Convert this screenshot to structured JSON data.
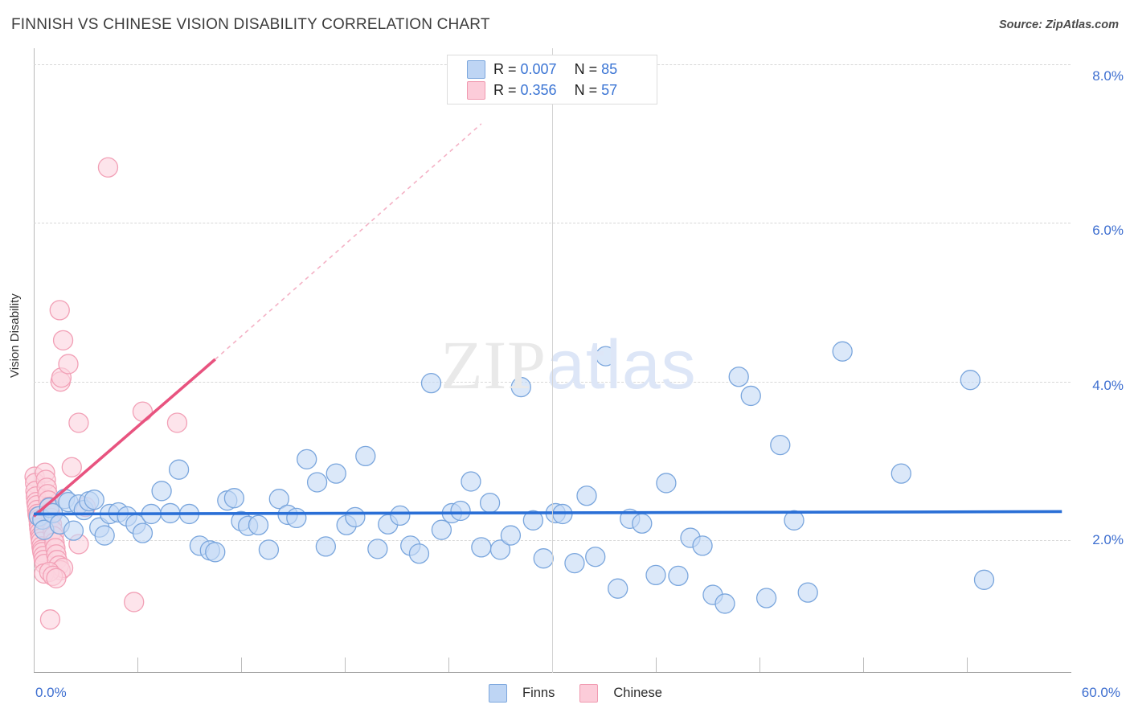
{
  "header": {
    "title": "FINNISH VS CHINESE VISION DISABILITY CORRELATION CHART",
    "source": "Source: ZipAtlas.com"
  },
  "watermark": {
    "zip": "ZIP",
    "atlas": "atlas"
  },
  "stats": {
    "finns": {
      "r_label": "R =",
      "r_value": "0.007",
      "n_label": "N =",
      "n_value": "85"
    },
    "chinese": {
      "r_label": "R =",
      "r_value": "0.356",
      "n_label": "N =",
      "n_value": "57"
    }
  },
  "legend": {
    "finns": "Finns",
    "chinese": "Chinese"
  },
  "colors": {
    "finns_fill": "#c5daf6",
    "finns_stroke": "#7aa6dd",
    "finns_trend": "#2a6fd6",
    "chinese_fill": "#fcd4de",
    "chinese_stroke": "#f2a0b6",
    "chinese_trend": "#e8537f",
    "axis_label": "#3e6fd0"
  },
  "chart_data": {
    "type": "scatter",
    "title": "FINNISH VS CHINESE VISION DISABILITY CORRELATION CHART",
    "xlabel": "",
    "ylabel": "Vision Disability",
    "xlim": [
      0.0,
      60.0
    ],
    "ylim": [
      0.0,
      8.6
    ],
    "x_tick_labels": [
      "0.0%",
      "60.0%"
    ],
    "y_tick_labels": [
      "2.0%",
      "4.0%",
      "6.0%",
      "8.0%"
    ],
    "y_ticks": [
      2.0,
      4.0,
      6.0,
      8.0
    ],
    "grid": true,
    "legend_position": "bottom",
    "series": [
      {
        "name": "Finns",
        "color": "#c5daf6",
        "r": 0.007,
        "n": 85,
        "trendline": {
          "x0": 0.0,
          "y0": 2.33,
          "x1": 59.5,
          "y1": 2.36
        },
        "points": [
          [
            0.3,
            2.3
          ],
          [
            0.5,
            2.26
          ],
          [
            0.6,
            2.13
          ],
          [
            0.9,
            2.41
          ],
          [
            1.1,
            2.34
          ],
          [
            1.5,
            2.2
          ],
          [
            1.8,
            2.52
          ],
          [
            2.0,
            2.48
          ],
          [
            2.3,
            2.12
          ],
          [
            2.6,
            2.45
          ],
          [
            2.9,
            2.38
          ],
          [
            3.2,
            2.49
          ],
          [
            3.5,
            2.51
          ],
          [
            3.8,
            2.16
          ],
          [
            4.1,
            2.06
          ],
          [
            4.4,
            2.33
          ],
          [
            4.9,
            2.35
          ],
          [
            5.4,
            2.3
          ],
          [
            5.9,
            2.2
          ],
          [
            6.3,
            2.09
          ],
          [
            6.8,
            2.33
          ],
          [
            7.4,
            2.62
          ],
          [
            7.9,
            2.34
          ],
          [
            8.4,
            2.89
          ],
          [
            9.0,
            2.33
          ],
          [
            9.6,
            1.93
          ],
          [
            10.2,
            1.87
          ],
          [
            10.5,
            1.85
          ],
          [
            11.2,
            2.5
          ],
          [
            11.6,
            2.53
          ],
          [
            12.0,
            2.24
          ],
          [
            12.4,
            2.18
          ],
          [
            13.0,
            2.19
          ],
          [
            13.6,
            1.88
          ],
          [
            14.2,
            2.52
          ],
          [
            14.7,
            2.32
          ],
          [
            15.2,
            2.28
          ],
          [
            15.8,
            3.02
          ],
          [
            16.4,
            2.73
          ],
          [
            16.9,
            1.92
          ],
          [
            17.5,
            2.84
          ],
          [
            18.1,
            2.19
          ],
          [
            18.6,
            2.29
          ],
          [
            19.2,
            3.06
          ],
          [
            19.9,
            1.89
          ],
          [
            20.5,
            2.2
          ],
          [
            21.2,
            2.31
          ],
          [
            21.8,
            1.93
          ],
          [
            22.3,
            1.83
          ],
          [
            23.0,
            3.98
          ],
          [
            23.6,
            2.13
          ],
          [
            24.2,
            2.34
          ],
          [
            24.7,
            2.37
          ],
          [
            25.3,
            2.74
          ],
          [
            25.9,
            1.91
          ],
          [
            26.4,
            2.47
          ],
          [
            27.0,
            1.88
          ],
          [
            27.6,
            2.06
          ],
          [
            28.2,
            3.93
          ],
          [
            28.9,
            2.25
          ],
          [
            29.5,
            1.77
          ],
          [
            30.2,
            2.34
          ],
          [
            30.6,
            2.33
          ],
          [
            31.3,
            1.71
          ],
          [
            32.0,
            2.56
          ],
          [
            32.5,
            1.79
          ],
          [
            33.1,
            4.32
          ],
          [
            33.8,
            1.39
          ],
          [
            34.5,
            2.27
          ],
          [
            35.2,
            2.21
          ],
          [
            36.0,
            1.56
          ],
          [
            36.6,
            2.72
          ],
          [
            37.3,
            1.55
          ],
          [
            38.0,
            2.03
          ],
          [
            38.7,
            1.93
          ],
          [
            39.3,
            1.31
          ],
          [
            40.0,
            1.2
          ],
          [
            40.8,
            4.06
          ],
          [
            41.5,
            3.82
          ],
          [
            42.4,
            1.27
          ],
          [
            43.2,
            3.2
          ],
          [
            44.0,
            2.25
          ],
          [
            44.8,
            1.34
          ],
          [
            46.8,
            4.38
          ],
          [
            50.2,
            2.84
          ],
          [
            54.2,
            4.02
          ],
          [
            55.0,
            1.5
          ]
        ]
      },
      {
        "name": "Chinese",
        "color": "#fcd4de",
        "r": 0.356,
        "n": 57,
        "trendline": {
          "x0": 0.0,
          "y0": 2.3,
          "x1": 10.5,
          "y1": 4.28
        },
        "trendline_dashed": {
          "x0": 10.5,
          "y0": 4.28,
          "x1": 25.9,
          "y1": 7.25
        },
        "points": [
          [
            0.05,
            2.8
          ],
          [
            0.08,
            2.72
          ],
          [
            0.1,
            2.62
          ],
          [
            0.12,
            2.55
          ],
          [
            0.15,
            2.48
          ],
          [
            0.18,
            2.44
          ],
          [
            0.2,
            2.38
          ],
          [
            0.22,
            2.33
          ],
          [
            0.25,
            2.3
          ],
          [
            0.28,
            2.26
          ],
          [
            0.3,
            2.2
          ],
          [
            0.32,
            2.15
          ],
          [
            0.35,
            2.1
          ],
          [
            0.38,
            2.05
          ],
          [
            0.4,
            2.02
          ],
          [
            0.42,
            1.98
          ],
          [
            0.45,
            1.92
          ],
          [
            0.48,
            1.88
          ],
          [
            0.5,
            1.85
          ],
          [
            0.55,
            1.8
          ],
          [
            0.58,
            1.75
          ],
          [
            0.62,
            1.7
          ],
          [
            0.65,
            2.85
          ],
          [
            0.7,
            2.76
          ],
          [
            0.75,
            2.66
          ],
          [
            0.8,
            2.58
          ],
          [
            0.85,
            2.5
          ],
          [
            0.9,
            2.42
          ],
          [
            0.95,
            2.35
          ],
          [
            1.0,
            2.28
          ],
          [
            1.05,
            2.2
          ],
          [
            1.1,
            2.12
          ],
          [
            1.15,
            2.05
          ],
          [
            1.2,
            1.97
          ],
          [
            1.25,
            1.9
          ],
          [
            1.3,
            1.82
          ],
          [
            1.35,
            1.75
          ],
          [
            1.45,
            1.68
          ],
          [
            1.55,
            1.62
          ],
          [
            1.7,
            1.65
          ],
          [
            0.6,
            1.58
          ],
          [
            0.9,
            1.6
          ],
          [
            1.1,
            1.55
          ],
          [
            1.3,
            1.52
          ],
          [
            2.2,
            2.92
          ],
          [
            2.6,
            3.48
          ],
          [
            1.55,
            4.0
          ],
          [
            1.6,
            4.05
          ],
          [
            2.0,
            4.22
          ],
          [
            1.7,
            4.52
          ],
          [
            1.5,
            4.9
          ],
          [
            4.3,
            6.7
          ],
          [
            0.95,
            1.0
          ],
          [
            2.6,
            1.95
          ],
          [
            3.0,
            2.42
          ],
          [
            6.3,
            3.62
          ],
          [
            8.3,
            3.48
          ],
          [
            5.8,
            1.22
          ]
        ]
      }
    ]
  }
}
